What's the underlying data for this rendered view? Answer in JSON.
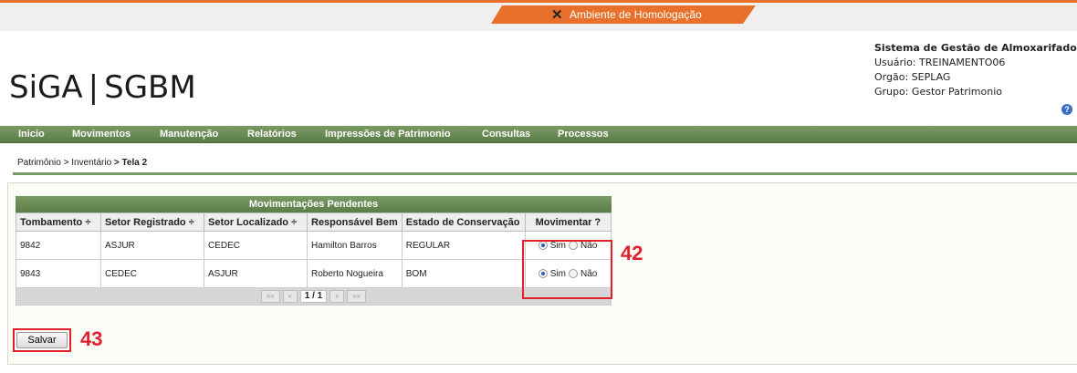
{
  "env": {
    "label": "Ambiente de Homologação",
    "icon": "wrench-icon",
    "accent": "#e8702a"
  },
  "header": {
    "logo_left": "SiGA",
    "logo_sep": "|",
    "logo_right": "SGBM",
    "system_title": "Sistema de Gestão de Almoxarifado",
    "user": "Usuário: TREINAMENTO06",
    "org": "Orgão: SEPLAG",
    "group": "Grupo: Gestor Patrimonio",
    "help_icon": "help-icon"
  },
  "nav": {
    "items": [
      "Inicio",
      "Movimentos",
      "Manutenção",
      "Relatórios",
      "Impressões de Patrimonio",
      "Consultas",
      "Processos"
    ],
    "color": "#5c7d48"
  },
  "breadcrumb": {
    "b1": "Patrimônio",
    "b2": "> Inventário",
    "b3": "> Tela 2"
  },
  "table": {
    "title": "Movimentações Pendentes",
    "headers": [
      "Tombamento",
      "Setor Registrado",
      "Setor Localizado",
      "Responsável Bem",
      "Estado de Conservação",
      "Movimentar ?"
    ],
    "sort_glyph": "÷",
    "rows": [
      {
        "tombamento": "9842",
        "setor_registrado": "ASJUR",
        "setor_localizado": "CEDEC",
        "responsavel": "Hamilton Barros",
        "estado": "REGULAR",
        "movimentar": "Sim"
      },
      {
        "tombamento": "9843",
        "setor_registrado": "CEDEC",
        "setor_localizado": "ASJUR",
        "responsavel": "Roberto Nogueira",
        "estado": "BOM",
        "movimentar": "Sim"
      }
    ],
    "radio_yes": "Sim",
    "radio_no": "Não",
    "pager": {
      "first": "««",
      "prev": "«",
      "current": "1 / 1",
      "next": "»",
      "last": "»»"
    }
  },
  "save_label": "Salvar",
  "annotations": {
    "radios": "42",
    "save": "43",
    "color": "#e0202a"
  }
}
